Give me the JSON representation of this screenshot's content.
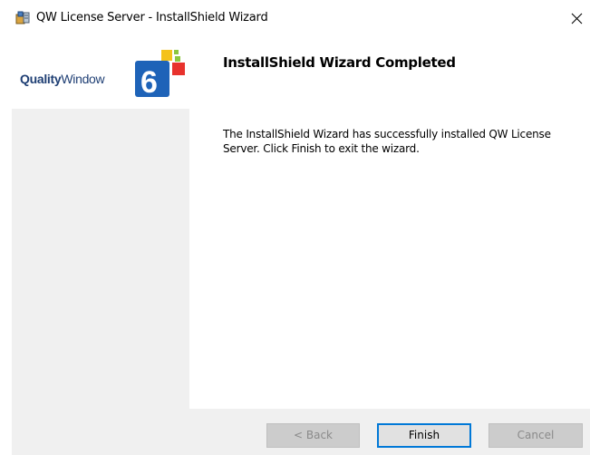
{
  "window": {
    "title": "QW License Server - InstallShield Wizard",
    "close_glyph": "✕",
    "icon": "installer-icon"
  },
  "logo": {
    "quality": "Quality",
    "window": "Window",
    "version": "6"
  },
  "content": {
    "heading": "InstallShield Wizard Completed",
    "description": "The InstallShield Wizard has successfully installed QW License Server. Click Finish to exit the wizard."
  },
  "buttons": {
    "back": "< Back",
    "finish": "Finish",
    "cancel": "Cancel"
  },
  "colors": {
    "logo_text": "#1f3f74",
    "logo_badge": "#1e63b8",
    "logo_squares": [
      "#f4c21a",
      "#8cc63f",
      "#e8322d"
    ],
    "focus_border": "#0078d7",
    "panel": "#f0f0f0"
  }
}
